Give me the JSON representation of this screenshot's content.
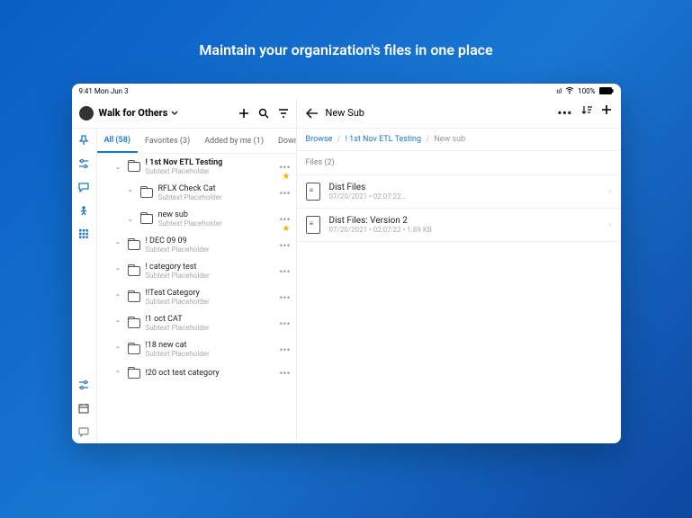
{
  "tagline": "Maintain your organization's files in one place",
  "status": {
    "time": "9:41 Mon Jun 3",
    "signal": "ııl",
    "wifi": "᯾",
    "battery": "100%"
  },
  "left": {
    "title": "Walk for Others",
    "tabs": [
      {
        "label": "All (58)",
        "active": true
      },
      {
        "label": "Favorites (3)"
      },
      {
        "label": "Added by me (1)"
      },
      {
        "label": "Down"
      }
    ],
    "tree": [
      {
        "name": "! 1st Nov ETL Testing",
        "sub": "Subtext Placeholder",
        "indent": 1,
        "bold": true,
        "open": true,
        "star": true
      },
      {
        "name": "RFLX Check Cat",
        "sub": "Subtext Placeholder",
        "indent": 2,
        "open": false
      },
      {
        "name": "new sub",
        "sub": "Subtext Placeholder",
        "indent": 2,
        "open": true,
        "star": true
      },
      {
        "name": "! DEC 09 09",
        "sub": "Subtext Placeholder",
        "indent": 1,
        "open": false
      },
      {
        "name": "! category test",
        "sub": "Subtext Placeholder",
        "indent": 1,
        "open": false
      },
      {
        "name": "!!Test Category",
        "sub": "Subtext Placeholder",
        "indent": 1,
        "open": false
      },
      {
        "name": "!1 oct CAT",
        "sub": "Subtext Placeholder",
        "indent": 1,
        "open": false
      },
      {
        "name": "!18 new cat",
        "sub": "Subtext Placeholder",
        "indent": 1,
        "open": false
      },
      {
        "name": "!20 oct test category",
        "sub": "",
        "indent": 1,
        "open": false
      }
    ]
  },
  "right": {
    "title": "New Sub",
    "crumbs": [
      "Browse",
      "! 1st Nov ETL Testing",
      "New sub"
    ],
    "files_header": "Files (2)",
    "files": [
      {
        "name": "Dist Files",
        "sub": "07/20/2021 • 02:07:22..."
      },
      {
        "name": "Dist Files: Version 2",
        "sub": "07/20/2021 • 02:07:22 • 1.89 KB"
      }
    ]
  }
}
